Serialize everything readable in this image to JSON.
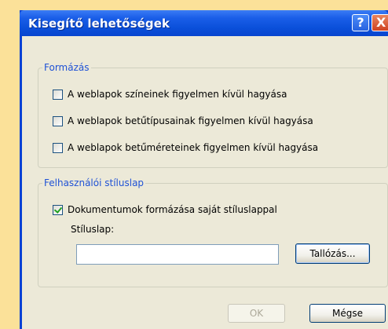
{
  "window": {
    "title": "Kisegítő lehetőségek",
    "help_symbol": "?",
    "close_symbol": "X"
  },
  "formatting": {
    "legend": "Formázás",
    "options": [
      {
        "label": "A weblapok színeinek figyelmen kívül hagyása",
        "checked": false
      },
      {
        "label": "A weblapok betűtípusainak figyelmen kívül hagyása",
        "checked": false
      },
      {
        "label": "A weblapok betűméreteinek figyelmen kívül hagyása",
        "checked": false
      }
    ]
  },
  "user_stylesheet": {
    "legend": "Felhasználói stíluslap",
    "option": {
      "label": "Dokumentumok formázása saját stíluslappal",
      "checked": true
    },
    "field_label": "Stíluslap:",
    "field_value": "",
    "browse_label": "Tallózás..."
  },
  "buttons": {
    "ok_label": "OK",
    "ok_enabled": false,
    "cancel_label": "Mégse"
  }
}
